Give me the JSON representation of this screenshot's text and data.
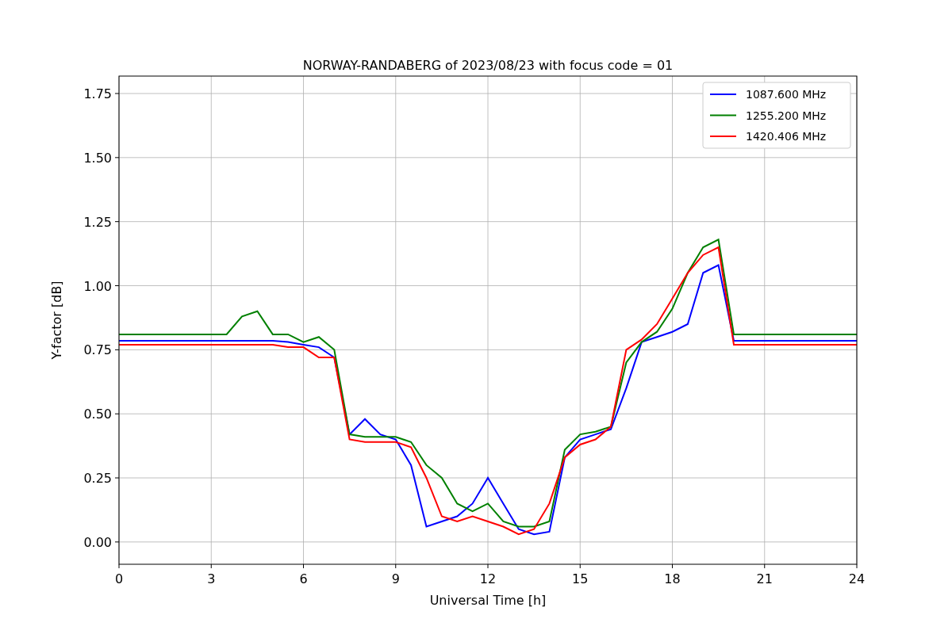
{
  "chart_data": {
    "type": "line",
    "title": "NORWAY-RANDABERG of 2023/08/23 with focus code = 01",
    "xlabel": "Universal Time [h]",
    "ylabel": "Y-factor [dB]",
    "x": [
      0,
      0.5,
      1,
      1.5,
      2,
      2.5,
      3,
      3.5,
      4,
      4.5,
      5,
      5.5,
      6,
      6.5,
      7,
      7.5,
      8,
      8.5,
      9,
      9.5,
      10,
      10.5,
      11,
      11.5,
      12,
      12.5,
      13,
      13.5,
      14,
      14.5,
      15,
      15.5,
      16,
      16.5,
      17,
      17.5,
      18,
      18.5,
      19,
      19.5,
      20,
      20.5,
      21,
      21.5,
      22,
      22.5,
      23,
      23.5,
      24
    ],
    "series": [
      {
        "name": "1087.600 MHz",
        "color": "#0000ff",
        "values": [
          0.785,
          0.785,
          0.785,
          0.785,
          0.785,
          0.785,
          0.785,
          0.785,
          0.785,
          0.785,
          0.785,
          0.78,
          0.77,
          0.76,
          0.72,
          0.42,
          0.48,
          0.42,
          0.4,
          0.3,
          0.06,
          0.08,
          0.1,
          0.15,
          0.25,
          0.15,
          0.05,
          0.03,
          0.04,
          0.33,
          0.4,
          0.42,
          0.44,
          0.6,
          0.78,
          0.8,
          0.82,
          0.85,
          1.05,
          1.08,
          0.785,
          0.785,
          0.785,
          0.785,
          0.785,
          0.785,
          0.785,
          0.785,
          0.785
        ]
      },
      {
        "name": "1255.200 MHz",
        "color": "#008000",
        "values": [
          0.81,
          0.81,
          0.81,
          0.81,
          0.81,
          0.81,
          0.81,
          0.81,
          0.88,
          0.9,
          0.81,
          0.81,
          0.78,
          0.8,
          0.75,
          0.42,
          0.41,
          0.41,
          0.41,
          0.39,
          0.3,
          0.25,
          0.15,
          0.12,
          0.15,
          0.08,
          0.06,
          0.06,
          0.08,
          0.36,
          0.42,
          0.43,
          0.45,
          0.7,
          0.78,
          0.82,
          0.91,
          1.05,
          1.15,
          1.18,
          0.81,
          0.81,
          0.81,
          0.81,
          0.81,
          0.81,
          0.81,
          0.81,
          0.81
        ]
      },
      {
        "name": "1420.406 MHz",
        "color": "#ff0000",
        "values": [
          0.77,
          0.77,
          0.77,
          0.77,
          0.77,
          0.77,
          0.77,
          0.77,
          0.77,
          0.77,
          0.77,
          0.76,
          0.76,
          0.72,
          0.72,
          0.4,
          0.39,
          0.39,
          0.39,
          0.37,
          0.25,
          0.1,
          0.08,
          0.1,
          0.08,
          0.06,
          0.03,
          0.05,
          0.15,
          0.33,
          0.38,
          0.4,
          0.45,
          0.75,
          0.79,
          0.85,
          0.95,
          1.05,
          1.12,
          1.15,
          0.77,
          0.77,
          0.77,
          0.77,
          0.77,
          0.77,
          0.77,
          0.77,
          0.77
        ]
      }
    ],
    "xlim": [
      0,
      24
    ],
    "ylim": [
      -0.087,
      1.818
    ],
    "xticks": [
      0,
      3,
      6,
      9,
      12,
      15,
      18,
      21,
      24
    ],
    "yticks": [
      {
        "value": 0,
        "label": "0.00"
      },
      {
        "value": 0.25,
        "label": "0.25"
      },
      {
        "value": 0.5,
        "label": "0.50"
      },
      {
        "value": 0.75,
        "label": "0.75"
      },
      {
        "value": 1,
        "label": "1.00"
      },
      {
        "value": 1.25,
        "label": "1.25"
      },
      {
        "value": 1.5,
        "label": "1.50"
      },
      {
        "value": 1.75,
        "label": "1.75"
      }
    ],
    "grid": true,
    "legend": true
  }
}
